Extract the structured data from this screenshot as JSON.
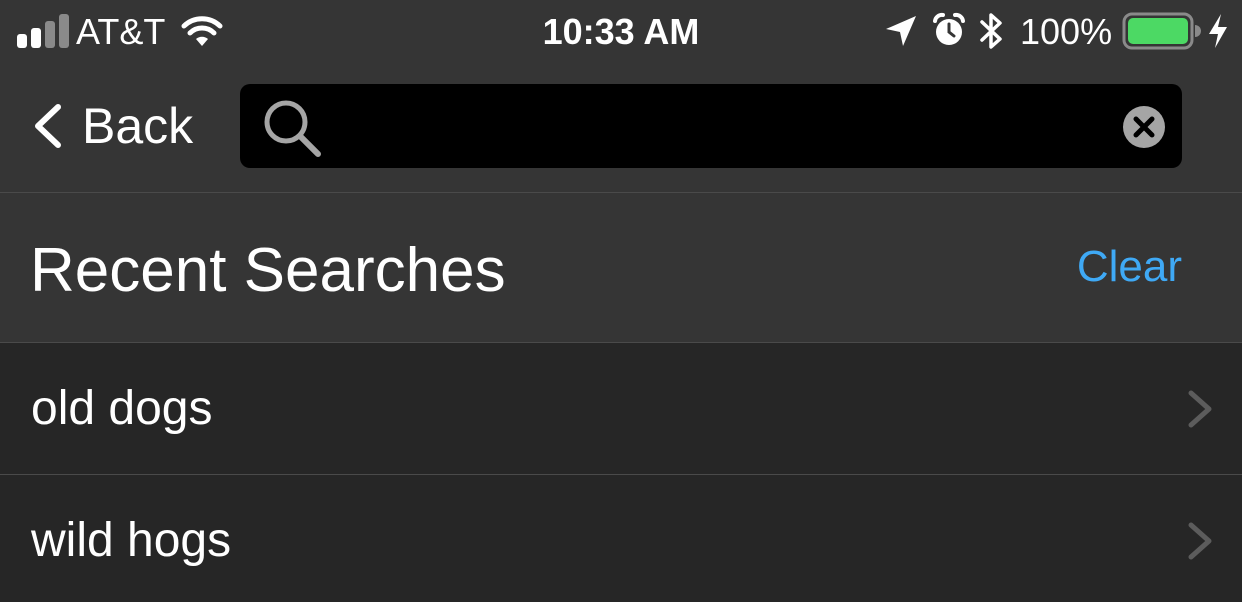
{
  "status_bar": {
    "carrier": "AT&T",
    "time": "10:33 AM",
    "battery_percent": "100%",
    "battery_level": 1.0,
    "signal_bars_filled": 2,
    "signal_bars_total": 4,
    "icons": [
      "signal-icon",
      "wifi-icon",
      "location-arrow-icon",
      "alarm-clock-icon",
      "bluetooth-icon",
      "battery-icon",
      "charging-bolt-icon"
    ]
  },
  "nav": {
    "back_label": "Back",
    "search": {
      "value": "",
      "placeholder": ""
    }
  },
  "recent": {
    "title": "Recent Searches",
    "clear_label": "Clear",
    "items": [
      {
        "label": "old dogs"
      },
      {
        "label": "wild hogs"
      }
    ]
  },
  "colors": {
    "background": "#262626",
    "bar_background": "#353535",
    "search_field": "#000000",
    "accent": "#3fa9f5",
    "battery_fill": "#4cd964",
    "separator": "#4a4a4a"
  }
}
